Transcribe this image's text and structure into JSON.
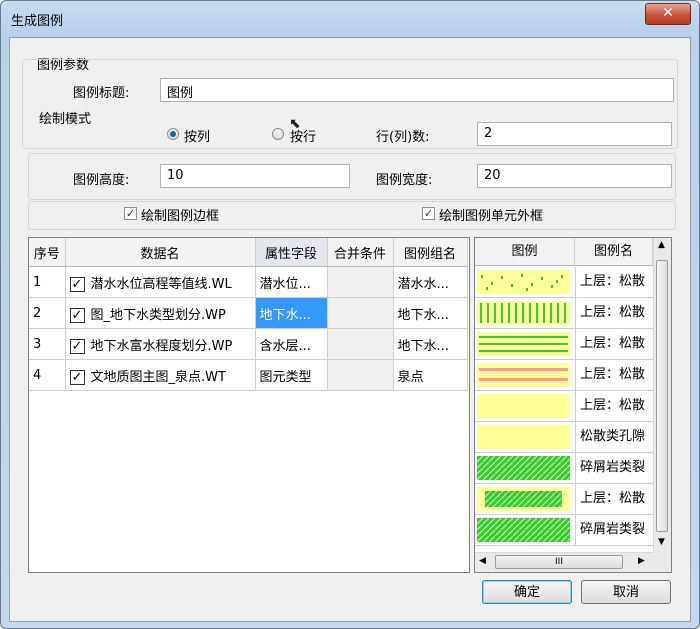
{
  "window": {
    "title": "生成图例",
    "close_glyph": "✕"
  },
  "params": {
    "group_label": "图例参数",
    "title_label": "图例标题:",
    "title_value": "图例",
    "mode_label": "绘制模式",
    "radio_col": "按列",
    "radio_row": "按行",
    "selected_mode": "按列",
    "rowcol_label": "行(列)数:",
    "rowcol_value": "2",
    "height_label": "图例高度:",
    "height_value": "10",
    "width_label": "图例宽度:",
    "width_value": "20",
    "draw_border_label": "绘制图例边框",
    "draw_border_checked": true,
    "draw_cell_border_label": "绘制图例单元外框",
    "draw_cell_border_checked": true
  },
  "data_table": {
    "columns": [
      "序号",
      "数据名",
      "属性字段",
      "合并条件",
      "图例组名"
    ],
    "rows": [
      {
        "index": "1",
        "checked": true,
        "name": "潜水水位高程等值线.WL",
        "field": "潜水位...",
        "merge": "",
        "group": "潜水水..."
      },
      {
        "index": "2",
        "checked": true,
        "name": "图_地下水类型划分.WP",
        "field": "地下水...",
        "merge": "",
        "group": "地下水..."
      },
      {
        "index": "3",
        "checked": true,
        "name": "地下水富水程度划分.WP",
        "field": "含水层...",
        "merge": "",
        "group": "地下水..."
      },
      {
        "index": "4",
        "checked": true,
        "name": "文地质图主图_泉点.WT",
        "field": "图元类型",
        "merge": "",
        "group": "泉点"
      }
    ]
  },
  "legend_table": {
    "columns": [
      "图例",
      "图例名"
    ],
    "rows": [
      {
        "name": "上层：松散"
      },
      {
        "name": "上层：松散"
      },
      {
        "name": "上层：松散"
      },
      {
        "name": "上层：松散"
      },
      {
        "name": "上层：松散"
      },
      {
        "name": "松散类孔隙"
      },
      {
        "name": "碎屑岩类裂"
      },
      {
        "name": "上层：松散"
      },
      {
        "name": "碎屑岩类裂"
      }
    ],
    "scroll_thumb_glyph": "III"
  },
  "buttons": {
    "ok": "确定",
    "cancel": "取消"
  },
  "colors": {
    "yellow": "#ffff99",
    "green": "#33cc33",
    "pink": "#ff9999",
    "selected": "#3399ff"
  }
}
